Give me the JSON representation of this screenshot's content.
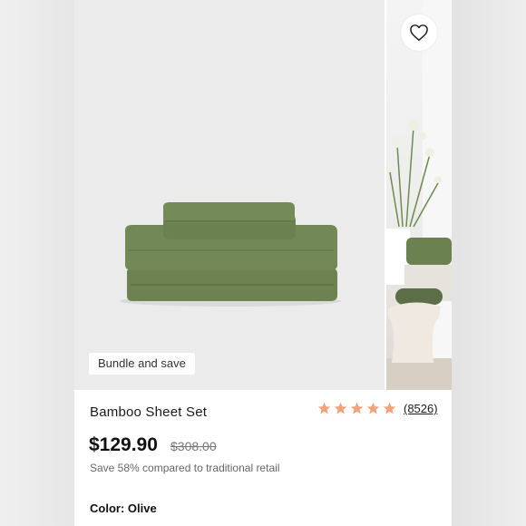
{
  "product": {
    "badge": "Bundle and save",
    "title": "Bamboo Sheet Set",
    "rating": {
      "stars": 5,
      "review_count": "(8526)"
    },
    "price": "$129.90",
    "original_price": "$308.00",
    "savings_text": "Save 58% compared to traditional retail",
    "color_label": "Color: Olive"
  },
  "colors": {
    "star": "#f2a37a",
    "sheet": "#6f8453",
    "image_bg": "#ebebeb"
  },
  "icons": {
    "wishlist": "heart-outline-icon",
    "star": "star-icon"
  }
}
